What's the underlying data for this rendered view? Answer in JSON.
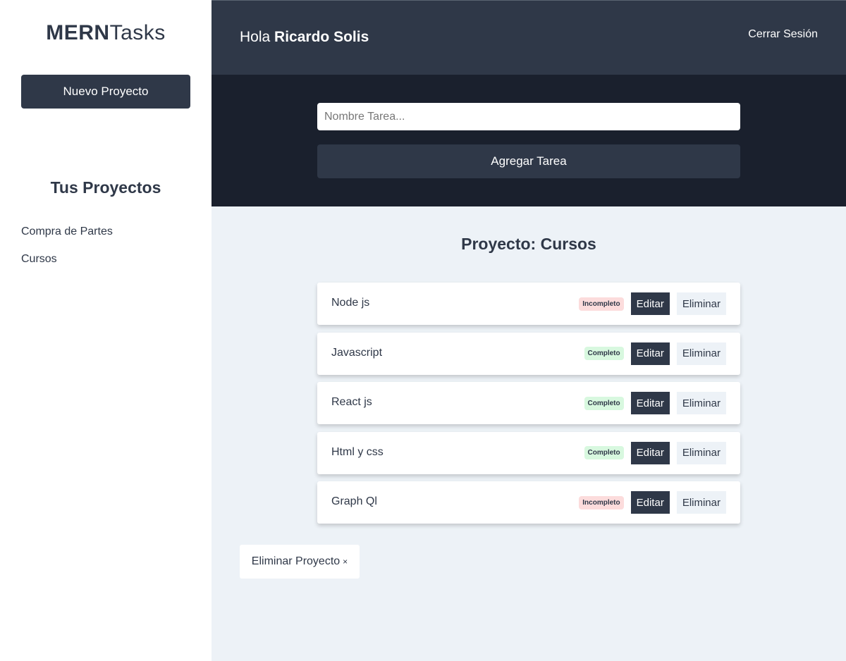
{
  "sidebar": {
    "logo_strong": "MERN",
    "logo_light": "Tasks",
    "new_project_label": "Nuevo Proyecto",
    "projects_title": "Tus Proyectos",
    "projects": [
      {
        "label": "Compra de Partes"
      },
      {
        "label": "Cursos"
      }
    ]
  },
  "header": {
    "greeting_prefix": "Hola",
    "user_name": "Ricardo Solis",
    "logout_label": "Cerrar Sesión"
  },
  "task_form": {
    "input_value": "",
    "input_placeholder": "Nombre Tarea...",
    "submit_label": "Agregar Tarea"
  },
  "project": {
    "heading_prefix": "Proyecto: ",
    "name": "Cursos",
    "delete_label": "Eliminar Proyecto",
    "delete_symbol": "×"
  },
  "tasks": [
    {
      "name": "Node js",
      "state": "Incompleto",
      "edit_label": "Editar",
      "delete_label": "Eliminar"
    },
    {
      "name": "Javascript",
      "state": "Completo",
      "edit_label": "Editar",
      "delete_label": "Eliminar"
    },
    {
      "name": "React js",
      "state": "Completo",
      "edit_label": "Editar",
      "delete_label": "Eliminar"
    },
    {
      "name": "Html y css",
      "state": "Completo",
      "edit_label": "Editar",
      "delete_label": "Eliminar"
    },
    {
      "name": "Graph Ql",
      "state": "Incompleto",
      "edit_label": "Editar",
      "delete_label": "Eliminar"
    }
  ],
  "colors": {
    "primary": "#2f3848",
    "dark_band": "#1a202d",
    "background": "#edf2f7",
    "incompleto": "#fcdcdc",
    "completo": "#d8f8df"
  }
}
